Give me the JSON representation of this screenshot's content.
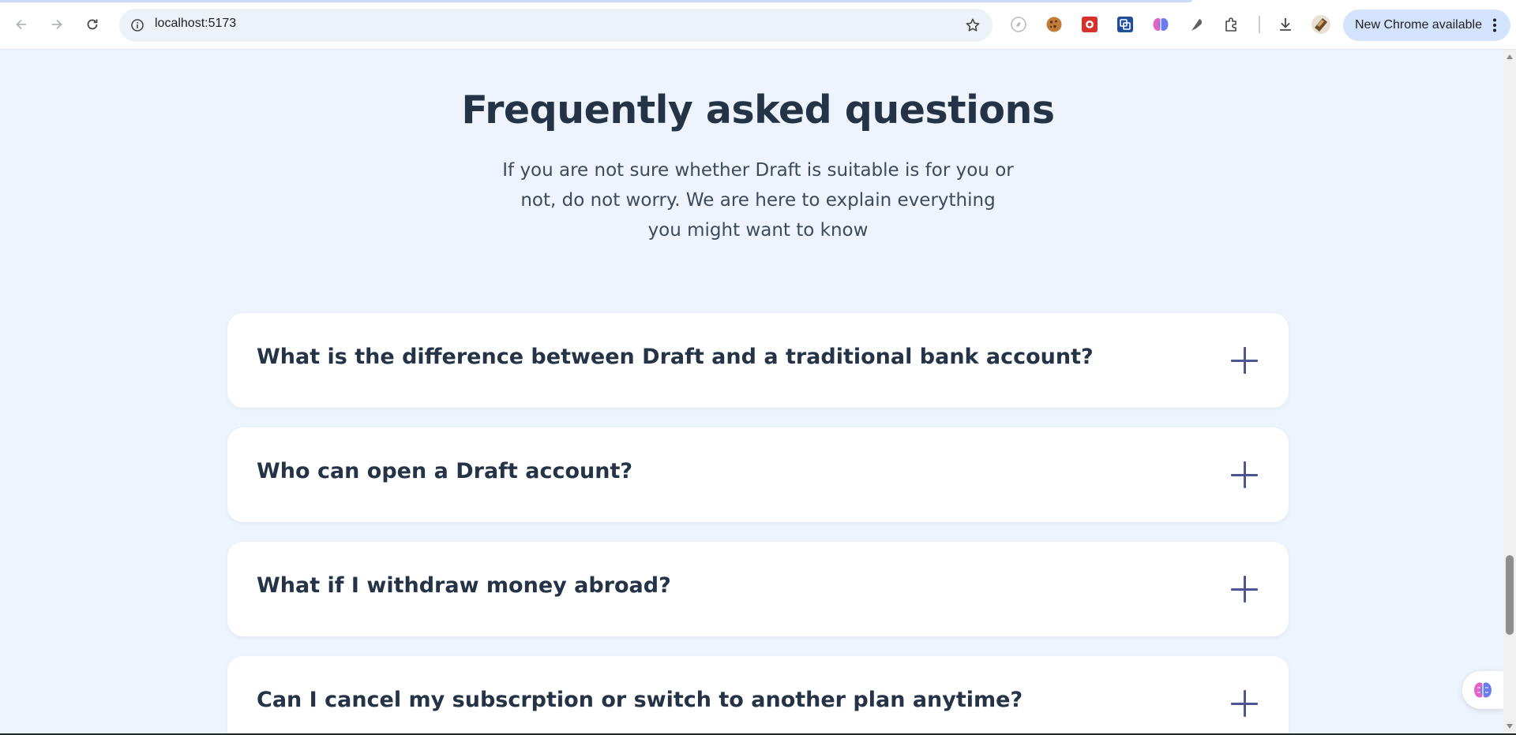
{
  "browser": {
    "url": "localhost:5173",
    "update_label": "New Chrome available",
    "icons": {
      "back": "back-arrow-icon",
      "forward": "forward-arrow-icon",
      "reload": "reload-icon",
      "site_info": "site-info-icon",
      "bookmark": "star-icon",
      "extensions": [
        "compass-extension-icon",
        "cookie-extension-icon",
        "red-extension-icon",
        "blue-extension-icon",
        "brain-extension-icon",
        "feather-extension-icon",
        "puzzle-extensions-icon"
      ],
      "downloads": "download-icon",
      "profile": "profile-avatar",
      "menu": "kebab-menu-icon"
    }
  },
  "faq": {
    "title": "Frequently asked questions",
    "subtitle": "If you are not sure whether Draft is suitable is for you or not, do not worry. We are here to explain everything you might want to know",
    "items": [
      {
        "question": "What is the difference between Draft and a traditional bank account?"
      },
      {
        "question": "Who can open a Draft account?"
      },
      {
        "question": "What if I withdraw money abroad?"
      },
      {
        "question": "Can I cancel my subscrption or switch to another plan anytime?"
      }
    ]
  },
  "colors": {
    "page_background": "#eef4fd",
    "card_background": "#ffffff",
    "heading_text": "#243346",
    "body_text": "#3d4a5a",
    "accent_plus": "#4d5691",
    "update_pill": "#d3e3fd"
  }
}
